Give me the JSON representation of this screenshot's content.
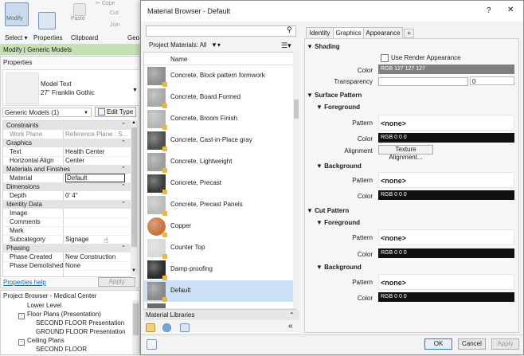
{
  "ribbon": {
    "modify": "Modify",
    "select": "Select",
    "properties": "Properties",
    "paste": "Paste",
    "clipboard": "Clipboard",
    "cope": "Cope",
    "cut": "Cut",
    "join": "Join",
    "geo": "Geo"
  },
  "context_bar": "Modify | Generic Models",
  "properties_panel": {
    "title": "Properties",
    "type_name": "Model Text",
    "type_sub": "27\" Franklin Gothic",
    "filter": "Generic Models (1)",
    "edit_type": "Edit Type",
    "groups": [
      {
        "name": "Constraints",
        "rows": [
          {
            "label": "Work Plane",
            "value": "Reference Plane : S..."
          }
        ]
      },
      {
        "name": "Graphics",
        "rows": [
          {
            "label": "Text",
            "value": "Health Center"
          },
          {
            "label": "Horizontal Align",
            "value": "Center"
          }
        ]
      },
      {
        "name": "Materials and Finishes",
        "rows": [
          {
            "label": "Material",
            "value": "Default"
          }
        ]
      },
      {
        "name": "Dimensions",
        "rows": [
          {
            "label": "Depth",
            "value": "0'  4\""
          }
        ]
      },
      {
        "name": "Identity Data",
        "rows": [
          {
            "label": "Image",
            "value": ""
          },
          {
            "label": "Comments",
            "value": ""
          },
          {
            "label": "Mark",
            "value": ""
          },
          {
            "label": "Subcategory",
            "value": "Signage"
          }
        ]
      },
      {
        "name": "Phasing",
        "rows": [
          {
            "label": "Phase Created",
            "value": "New Construction"
          },
          {
            "label": "Phase Demolished",
            "value": "None"
          }
        ]
      }
    ],
    "help_link": "Properties help",
    "apply": "Apply"
  },
  "project_browser": {
    "title": "Project Browser - Medical Center",
    "items": [
      {
        "label": "Lower Level",
        "indent": 3
      },
      {
        "label": "Floor Plans (Presentation)",
        "indent": 2
      },
      {
        "label": "SECOND FLOOR Presentation",
        "indent": 4
      },
      {
        "label": "GROUND FLOOR Presentation",
        "indent": 4
      },
      {
        "label": "Ceiling Plans",
        "indent": 2
      },
      {
        "label": "SECOND FLOOR",
        "indent": 4
      }
    ]
  },
  "dialog": {
    "title": "Material Browser - Default",
    "help": "?",
    "close": "✕",
    "search_placeholder": "",
    "project_materials": "Project Materials: All",
    "name_header": "Name",
    "materials": [
      {
        "name": "Concrete, Block pattern formwork",
        "swatch": "#8f8f8f"
      },
      {
        "name": "Concrete, Board Formed",
        "swatch": "#a9a9a9"
      },
      {
        "name": "Concrete, Broom Finish",
        "swatch": "#b5b5b5"
      },
      {
        "name": "Concrete, Cast-in-Place gray",
        "swatch": "#4f4f4f"
      },
      {
        "name": "Concrete, Lightweight",
        "swatch": "#9d9d9d"
      },
      {
        "name": "Concrete, Precast",
        "swatch": "#3c3c3c"
      },
      {
        "name": "Concrete, Precast Panels",
        "swatch": "#bdbdbd"
      },
      {
        "name": "Copper",
        "swatch": "#c8733d"
      },
      {
        "name": "Counter Top",
        "swatch": "#d9d9d9"
      },
      {
        "name": "Damp-proofing",
        "swatch": "#2b2b2b"
      },
      {
        "name": "Default",
        "swatch": "#8a8a8a"
      }
    ],
    "material_libraries": "Material Libraries",
    "tabs": [
      "Identity",
      "Graphics",
      "Appearance",
      "+"
    ],
    "shading": {
      "title": "Shading",
      "use_render": "Use Render Appearance",
      "color_label": "Color",
      "color_value": "RGB 127 127 127",
      "transparency_label": "Transparency",
      "transparency_value": "0"
    },
    "surface_pattern": {
      "title": "Surface Pattern",
      "foreground": "Foreground",
      "fg_pattern_label": "Pattern",
      "fg_pattern_value": "<none>",
      "fg_color_label": "Color",
      "fg_color_value": "RGB 0 0 0",
      "alignment_label": "Alignment",
      "alignment_button": "Texture Alignment...",
      "background": "Background",
      "bg_pattern_label": "Pattern",
      "bg_pattern_value": "<none>",
      "bg_color_label": "Color",
      "bg_color_value": "RGB 0 0 0"
    },
    "cut_pattern": {
      "title": "Cut Pattern",
      "foreground": "Foreground",
      "fg_pattern_label": "Pattern",
      "fg_pattern_value": "<none>",
      "fg_color_label": "Color",
      "fg_color_value": "RGB 0 0 0",
      "background": "Background",
      "bg_pattern_label": "Pattern",
      "bg_pattern_value": "<none>",
      "bg_color_label": "Color",
      "bg_color_value": "RGB 0 0 0"
    },
    "ok": "OK",
    "cancel": "Cancel",
    "apply": "Apply"
  }
}
